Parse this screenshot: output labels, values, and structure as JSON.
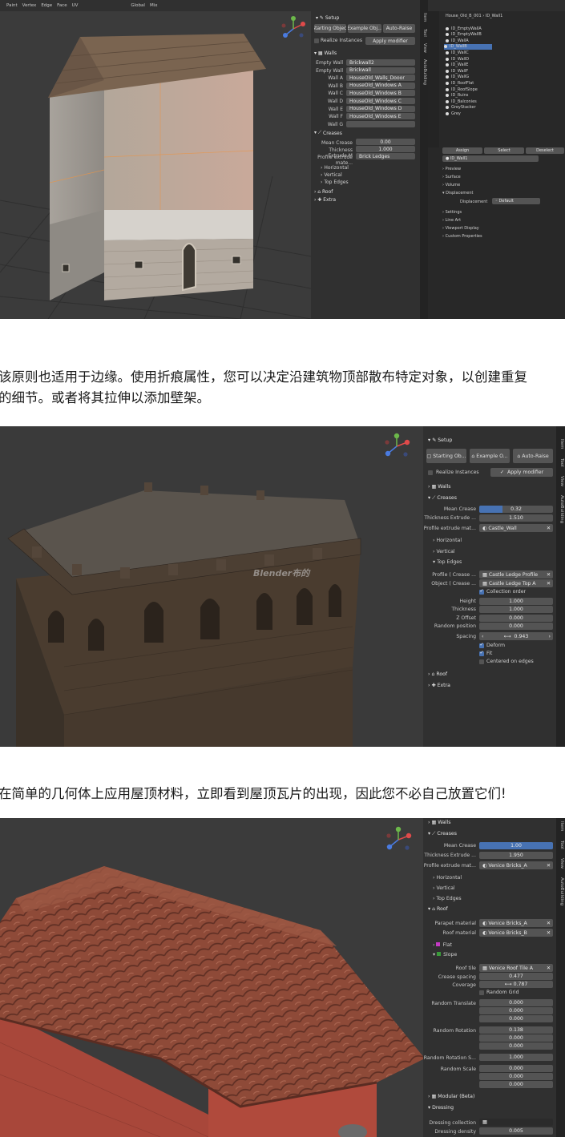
{
  "captions": {
    "one_line1": "该原则也适用于边缘。使用折痕属性，您可以决定沿建筑物顶部散布特定对象，以创建重复",
    "one_line2": "的细节。或者将其拉伸以添加壁架。",
    "two": "在简单的几何体上应用屋顶材料，立即看到屋顶瓦片的出现，因此您不必自己放置它们!"
  },
  "shot1": {
    "topbar": [
      "Paint",
      "Vertex",
      "Edge",
      "Face",
      "UV",
      "Global",
      "Mix"
    ],
    "outliner": {
      "path": [
        "House_Old_B_001",
        "ID_Wall1"
      ],
      "items": [
        "ID_EmptyWallA",
        "ID_EmptyWallB",
        "ID_WallA",
        "ID_WallB",
        "ID_WallC",
        "ID_WallD",
        "ID_WallE",
        "ID_WallF",
        "ID_WallG",
        "ID_RoofFlat",
        "ID_RoofSlope",
        "ID_Ruins",
        "ID_Balconies",
        "GreyStacker",
        "Grey"
      ]
    },
    "props": {
      "assign": "Assign",
      "select": "Select",
      "deselect": "Deselect",
      "attr": "ID_Wall1",
      "sections": [
        "Preview",
        "Surface",
        "Volume",
        "Displacement"
      ],
      "displacement_label": "Displacement",
      "displacement_value": "Default",
      "sections2": [
        "Settings",
        "Line Art",
        "Viewport Display",
        "Custom Properties"
      ]
    },
    "modifier": {
      "setup": "Setup",
      "starting": "Starting Object",
      "example": "Example Obj...",
      "autoraise": "Auto-Raise",
      "realize": "Realize Instances",
      "apply": "Apply modifier",
      "walls": "Walls",
      "wall_rows": [
        {
          "label": "Empty Wall",
          "value": "Brickwall2"
        },
        {
          "label": "Empty Wall",
          "value": "Brickwall"
        },
        {
          "label": "Wall A",
          "value": "HouseOld_Walls_Dooor"
        },
        {
          "label": "Wall B",
          "value": "HouseOld_Windows A"
        },
        {
          "label": "Wall C",
          "value": "HouseOld_Windows B"
        },
        {
          "label": "Wall D",
          "value": "HouseOld_Windows C"
        },
        {
          "label": "Wall E",
          "value": "HouseOld_Windows D"
        },
        {
          "label": "Wall F",
          "value": "HouseOld_Windows E"
        },
        {
          "label": "Wall G",
          "value": ""
        }
      ],
      "creases": "Creases",
      "mean_crease": "Mean Crease",
      "mean_crease_value": "0.00",
      "thickness": "Thickness Extrude M",
      "thickness_value": "1.000",
      "profile": "Profile extrude mate...",
      "profile_value": "Brick Ledges",
      "subsections": [
        "Horizontal",
        "Vertical",
        "Top Edges"
      ],
      "roof": "Roof",
      "extra": "Extra"
    },
    "tab_labels": [
      "Item",
      "Tool",
      "View",
      "AutoBuilding"
    ]
  },
  "shot2": {
    "watermark": "Blender布的",
    "setup": "Setup",
    "starting": "Starting Ob...",
    "example": "Example O...",
    "autoraise": "Auto-Raise",
    "realize": "Realize Instances",
    "apply": "Apply modifier",
    "walls": "Walls",
    "creases": "Creases",
    "mean_crease": "Mean Crease",
    "mean_crease_value": "0.32",
    "mean_crease_frac": 0.32,
    "thickness": "Thickness Extrude ...",
    "thickness_value": "1.510",
    "profile": "Profile extrude mat...",
    "profile_value": "Castle_Wall",
    "horizontal": "Horizontal",
    "vertical": "Vertical",
    "top_edges": "Top Edges",
    "profile_crease": "Profile ( Crease ...",
    "profile_crease_value": "Castle Ledge Profile",
    "object_crease": "Object ( Crease ...",
    "object_crease_value": "Castle Ledge Top A",
    "collection_order": "Collection order",
    "fields": [
      {
        "label": "Height",
        "value": "1.000"
      },
      {
        "label": "Thickness",
        "value": "1.000"
      },
      {
        "label": "Z Offset",
        "value": "0.000"
      },
      {
        "label": "Random position",
        "value": "0.000"
      }
    ],
    "spacing": "Spacing",
    "spacing_value": "0.943",
    "deform": "Deform",
    "fit": "Fit",
    "centered": "Centered on edges",
    "roof": "Roof",
    "extra": "Extra",
    "tab_labels": [
      "Item",
      "Tool",
      "View",
      "AutoBuilding"
    ]
  },
  "shot3": {
    "walls": "Walls",
    "creases": "Creases",
    "mean_crease": "Mean Crease",
    "mean_crease_value": "1.00",
    "mean_crease_frac": 1.0,
    "thickness": "Thickness Extrude ...",
    "thickness_value": "1.950",
    "profile": "Profile extrude mat...",
    "profile_value": "Venice Bricks_A",
    "horizontal": "Horizontal",
    "vertical": "Vertical",
    "top_edges": "Top Edges",
    "roof": "Roof",
    "parapet": "Parapet material",
    "parapet_value": "Venice Bricks_A",
    "roofmat": "Roof material",
    "roofmat_value": "Venice Bricks_B",
    "flat": "Flat",
    "slope": "Slope",
    "roof_tile": "Roof tile",
    "roof_tile_value": "Venice Roof Tile A",
    "crease_spacing": "Crease spacing",
    "crease_spacing_value": "0.477",
    "coverage": "Coverage",
    "coverage_value": "0.787",
    "random_grid": "Random Grid",
    "random_translate": "Random Translate",
    "random_translate_values": [
      "0.000",
      "0.000",
      "0.000"
    ],
    "random_rotation": "Random Rotation",
    "random_rotation_values": [
      "0.138",
      "0.000",
      "0.000"
    ],
    "random_rotation_s": "Random Rotation S...",
    "random_rotation_s_value": "1.000",
    "random_scale": "Random Scale",
    "random_scale_values": [
      "0.000",
      "0.000",
      "0.000"
    ],
    "modular": "Modular (Beta)",
    "dressing": "Dressing",
    "dressing_collection": "Dressing collection",
    "dressing_density": "Dressing density",
    "dressing_density_value": "0.005",
    "tab_labels": [
      "Item",
      "Tool",
      "View",
      "AutoBuilding"
    ]
  }
}
